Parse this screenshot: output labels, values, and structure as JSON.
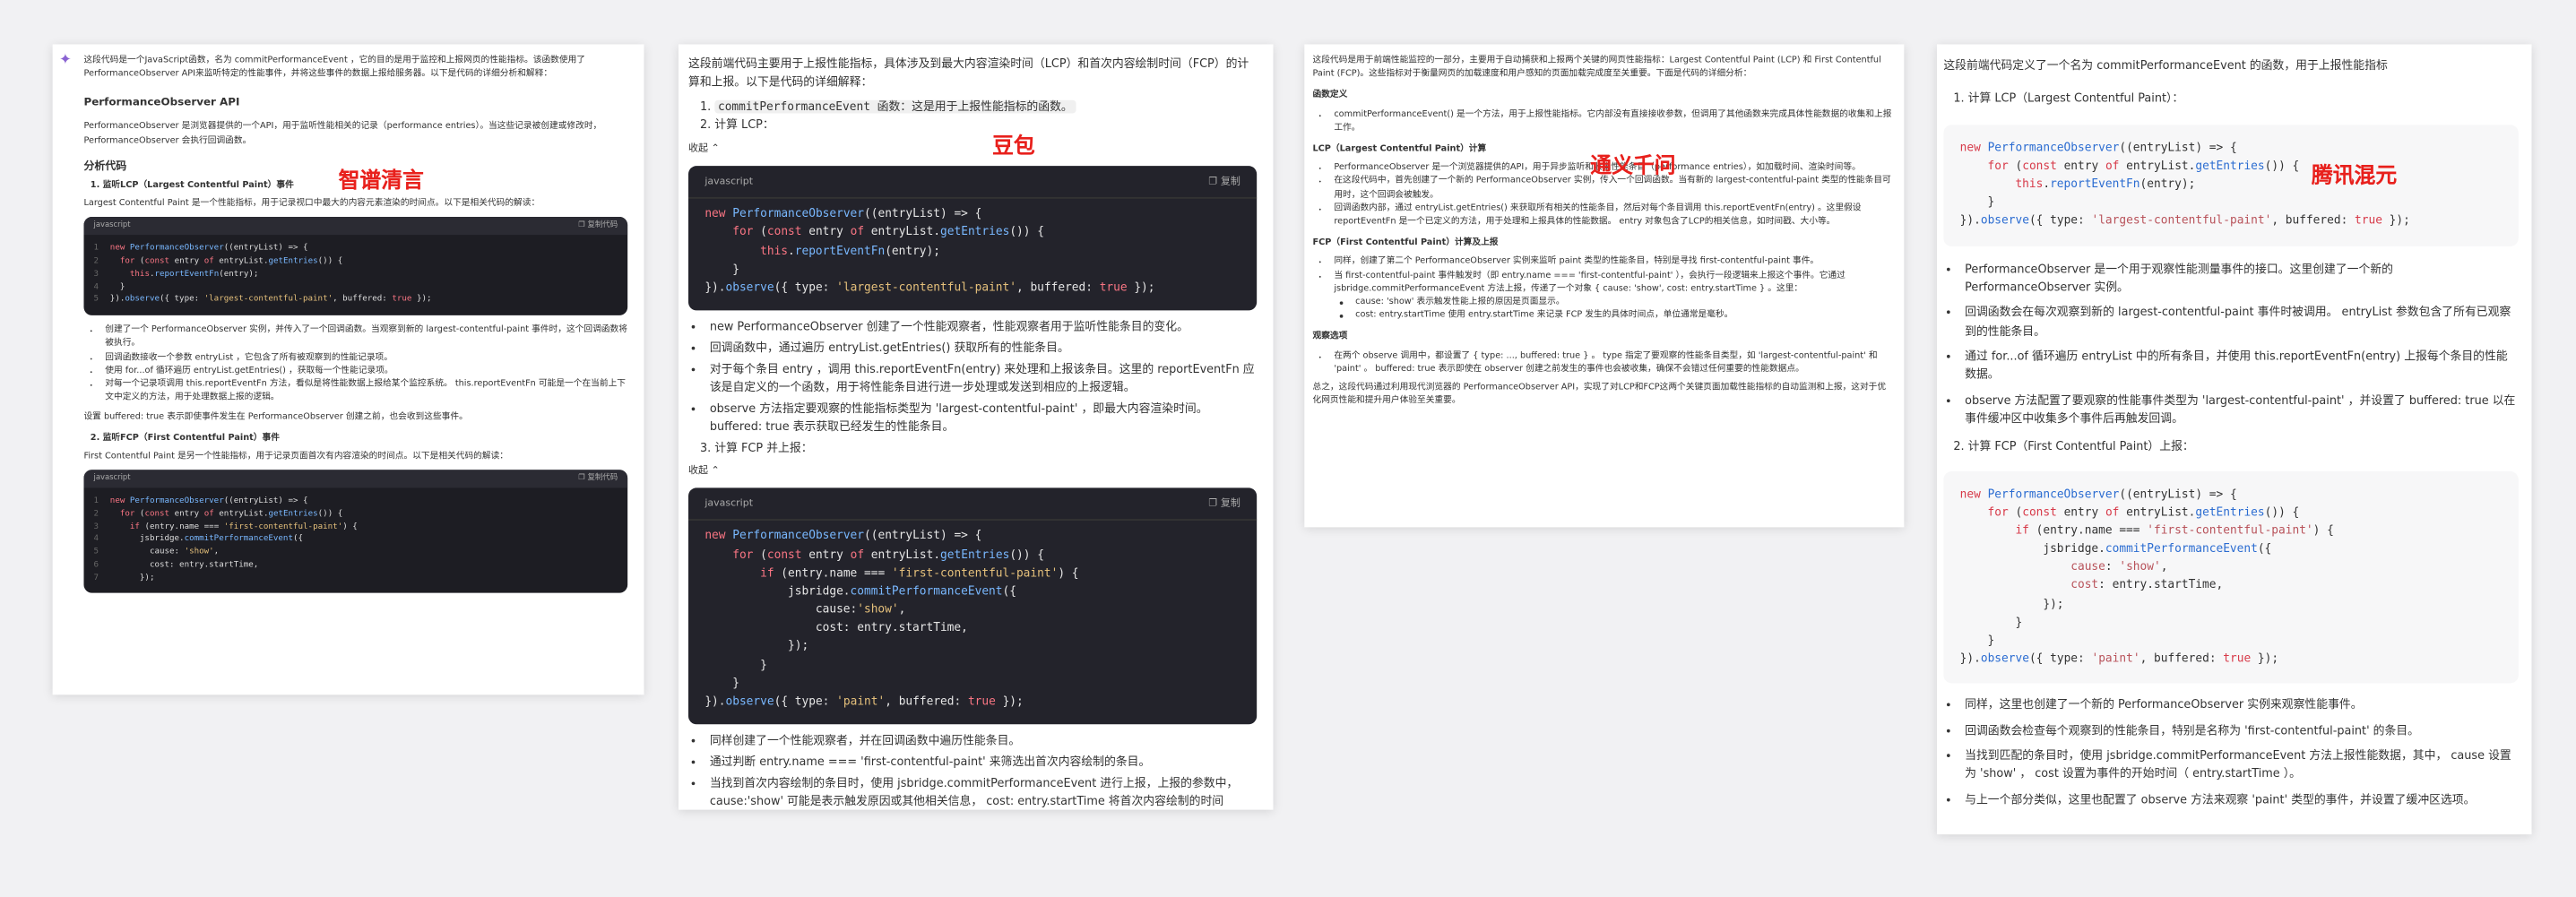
{
  "labels": {
    "zhipu": "智谱清言",
    "doubao": "豆包",
    "tongyi": "通义千问",
    "hunyuan": "腾讯混元"
  },
  "colors": {
    "brand_label": "#e8201c",
    "code_dark": "#1d1d23",
    "code_light": "#f7f7f8"
  },
  "icons": [
    "star-sparkle-icon",
    "copy-icon",
    "chevron-up-icon"
  ],
  "p1": {
    "intro": "这段代码是一个JavaScript函数，名为 commitPerformanceEvent ，它的目的是用于监控和上报网页的性能指标。该函数使用了 PerformanceObserver API来监听特定的性能事件，并将这些事件的数据上报给服务器。以下是代码的详细分析和解释：",
    "h_api": "PerformanceObserver API",
    "api_desc": "PerformanceObserver 是浏览器提供的一个API，用于监听性能相关的记录（performance entries）。当这些记录被创建或修改时， PerformanceObserver 会执行回调函数。",
    "h_analysis": "分析代码",
    "s1_title": "1. 监听LCP（Largest Contentful Paint）事件",
    "s1_desc": "Largest Contentful Paint 是一个性能指标，用于记录视口中最大的内容元素渲染的时间点。以下是相关代码的解读：",
    "code_lang": "javascript",
    "copy_label": "复制代码",
    "code1_lines": [
      "new PerformanceObserver((entryList) => {",
      "  for (const entry of entryList.getEntries()) {",
      "    this.reportEventFn(entry);",
      "  }",
      "}).observe({ type: 'largest-contentful-paint', buffered: true });"
    ],
    "b1": [
      "创建了一个 PerformanceObserver 实例，并传入了一个回调函数。当观察到新的 largest-contentful-paint 事件时，这个回调函数将被执行。",
      "回调函数接收一个参数 entryList ，它包含了所有被观察到的性能记录项。",
      "使用 for...of 循环遍历 entryList.getEntries() ，获取每一个性能记录项。",
      "对每一个记录项调用 this.reportEventFn 方法，看似是将性能数据上报给某个监控系统。 this.reportEventFn 可能是一个在当前上下文中定义的方法，用于处理数据上报的逻辑。"
    ],
    "buffered_note": "设置 buffered: true 表示即使事件发生在 PerformanceObserver 创建之前，也会收到这些事件。",
    "s2_title": "2. 监听FCP（First Contentful Paint）事件",
    "s2_desc": "First Contentful Paint 是另一个性能指标，用于记录页面首次有内容渲染的时间点。以下是相关代码的解读：",
    "code2_lines": [
      "new PerformanceObserver((entryList) => {",
      "  for (const entry of entryList.getEntries()) {",
      "    if (entry.name === 'first-contentful-paint') {",
      "      jsbridge.commitPerformanceEvent({",
      "        cause: 'show',",
      "        cost: entry.startTime,",
      "      });"
    ]
  },
  "p2": {
    "intro": "这段前端代码主要用于上报性能指标，具体涉及到最大内容渲染时间（LCP）和首次内容绘制时间（FCP）的计算和上报。以下是代码的详细解释：",
    "item1": "commitPerformanceEvent 函数：这是用于上报性能指标的函数。",
    "item2": "计算 LCP：",
    "collapse_label": "收起",
    "code_lang": "javascript",
    "copy_label": "复制",
    "code1_lines": [
      "new PerformanceObserver((entryList) => {",
      "    for (const entry of entryList.getEntries()) {",
      "        this.reportEventFn(entry);",
      "    }",
      "}).observe({ type: 'largest-contentful-paint', buffered: true });"
    ],
    "b1": [
      "new PerformanceObserver 创建了一个性能观察者，性能观察者用于监听性能条目的变化。",
      "回调函数中，通过遍历 entryList.getEntries() 获取所有的性能条目。",
      "对于每个条目 entry ，调用 this.reportEventFn(entry) 来处理和上报该条目。这里的 reportEventFn 应该是自定义的一个函数，用于将性能条目进行进一步处理或发送到相应的上报逻辑。",
      "observe 方法指定要观察的性能指标类型为 'largest-contentful-paint' ，即最大内容渲染时间。 buffered: true 表示获取已经发生的性能条目。"
    ],
    "item3": "计算 FCP 并上报：",
    "code2_lines": [
      "new PerformanceObserver((entryList) => {",
      "    for (const entry of entryList.getEntries()) {",
      "        if (entry.name === 'first-contentful-paint') {",
      "            jsbridge.commitPerformanceEvent({",
      "                cause:'show',",
      "                cost: entry.startTime,",
      "            });",
      "        }",
      "    }",
      "}).observe({ type: 'paint', buffered: true });"
    ],
    "b2": [
      "同样创建了一个性能观察者，并在回调函数中遍历性能条目。",
      "通过判断 entry.name === 'first-contentful-paint' 来筛选出首次内容绘制的条目。",
      "当找到首次内容绘制的条目时，使用 jsbridge.commitPerformanceEvent 进行上报，上报的参数中，cause:'show' 可能是表示触发原因或其他相关信息， cost: entry.startTime 将首次内容绘制的时间"
    ]
  },
  "p3": {
    "intro": "这段代码是用于前端性能监控的一部分，主要用于自动捕获和上报两个关键的网页性能指标：Largest Contentful Paint (LCP) 和 First Contentful Paint (FCP)。这些指标对于衡量网页的加载速度和用户感知的页面加载完成度至关重要。下面是代码的详细分析：",
    "h_def": "函数定义",
    "def_items": [
      "commitPerformanceEvent() 是一个方法，用于上报性能指标。它内部没有直接接收参数，但调用了其他函数来完成具体性能数据的收集和上报工作。"
    ],
    "h_lcp": "LCP（Largest Contentful Paint）计算",
    "lcp_items": [
      "PerformanceObserver 是一个浏览器提供的API，用于异步监听和收集性能条目（performance entries），如加载时间、渲染时间等。",
      "在这段代码中，首先创建了一个新的 PerformanceObserver 实例，传入一个回调函数。当有新的 largest-contentful-paint 类型的性能条目可用时，这个回调会被触发。",
      "回调函数内部，通过 entryList.getEntries() 来获取所有相关的性能条目，然后对每个条目调用 this.reportEventFn(entry) 。这里假设 reportEventFn 是一个已定义的方法，用于处理和上报具体的性能数据。 entry 对象包含了LCP的相关信息，如时间戳、大小等。"
    ],
    "h_fcp": "FCP（First Contentful Paint）计算及上报",
    "fcp_items": [
      "同样，创建了第二个 PerformanceObserver 实例来监听 paint 类型的性能条目，特别是寻找 first-contentful-paint 事件。",
      "当 first-contentful-paint 事件触发时（即 entry.name === 'first-contentful-paint' ），会执行一段逻辑来上报这个事件。它通过 jsbridge.commitPerformanceEvent 方法上报，传递了一个对象 { cause: 'show', cost: entry.startTime } 。这里："
    ],
    "fcp_sub": [
      "cause: 'show' 表示触发性能上报的原因是页面显示。",
      "cost: entry.startTime 使用 entry.startTime 来记录 FCP 发生的具体时间点，单位通常是毫秒。"
    ],
    "h_obs": "观察选项",
    "obs_items": [
      "在两个 observe 调用中，都设置了 { type: ..., buffered: true } 。 type 指定了要观察的性能条目类型，如 'largest-contentful-paint' 和 'paint' 。 buffered: true 表示即使在 observer 创建之前发生的事件也会被收集，确保不会错过任何重要的性能数据点。"
    ],
    "summary": "总之，这段代码通过利用现代浏览器的 PerformanceObserver API，实现了对LCP和FCP这两个关键页面加载性能指标的自动监测和上报，这对于优化网页性能和提升用户体验至关重要。"
  },
  "p4": {
    "intro": "这段前端代码定义了一个名为 commitPerformanceEvent 的函数，用于上报性能指标",
    "s1": "1. 计算 LCP（Largest Contentful Paint）：",
    "code1_lines": [
      "new PerformanceObserver((entryList) => {",
      "    for (const entry of entryList.getEntries()) {",
      "        this.reportEventFn(entry);",
      "    }",
      "}).observe({ type: 'largest-contentful-paint', buffered: true });"
    ],
    "b1": [
      "PerformanceObserver 是一个用于观察性能测量事件的接口。这里创建了一个新的 PerformanceObserver 实例。",
      "回调函数会在每次观察到新的 largest-contentful-paint 事件时被调用。 entryList 参数包含了所有已观察到的性能条目。",
      "通过 for...of 循环遍历 entryList 中的所有条目，并使用 this.reportEventFn(entry) 上报每个条目的性能数据。",
      "observe 方法配置了要观察的性能事件类型为 'largest-contentful-paint' ，并设置了 buffered: true 以在事件缓冲区中收集多个事件后再触发回调。"
    ],
    "s2": "2. 计算 FCP（First Contentful Paint）上报：",
    "code2_lines": [
      "new PerformanceObserver((entryList) => {",
      "    for (const entry of entryList.getEntries()) {",
      "        if (entry.name === 'first-contentful-paint') {",
      "            jsbridge.commitPerformanceEvent({",
      "                cause: 'show',",
      "                cost: entry.startTime,",
      "            });",
      "        }",
      "    }",
      "}).observe({ type: 'paint', buffered: true });"
    ],
    "b2": [
      "同样，这里也创建了一个新的 PerformanceObserver 实例来观察性能事件。",
      "回调函数会检查每个观察到的性能条目，特别是名称为 'first-contentful-paint' 的条目。",
      "当找到匹配的条目时，使用 jsbridge.commitPerformanceEvent 方法上报性能数据，其中， cause 设置为 'show' ， cost 设置为事件的开始时间（ entry.startTime ）。",
      "与上一个部分类似，这里也配置了 observe 方法来观察 'paint' 类型的事件，并设置了缓冲区选项。"
    ]
  }
}
